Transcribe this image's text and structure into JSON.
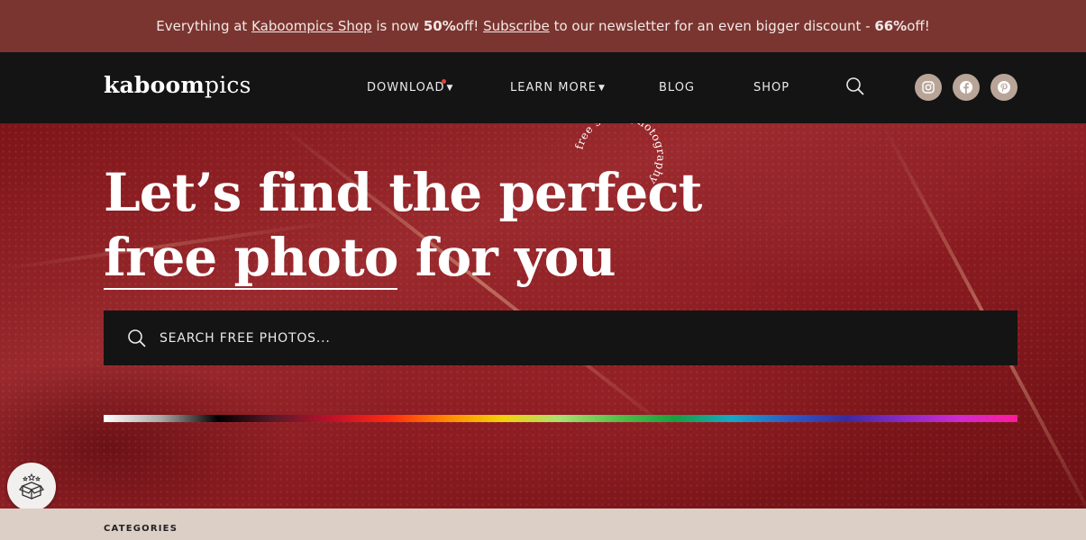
{
  "promo": {
    "prefix": "Everything at ",
    "shop_link": "Kaboompics Shop",
    "middle": " is now ",
    "discount1": "50%",
    "after_discount1": " off! ",
    "subscribe_link": "Subscribe",
    "after_subscribe": " to our newsletter for an even bigger discount - ",
    "discount2": "66%",
    "suffix": " off!",
    "background": "#7a3530"
  },
  "nav": {
    "logo_bold": "kaboom",
    "logo_light": "pics",
    "items": [
      {
        "label": "DOWNLOAD",
        "has_caret": true,
        "has_dot": true
      },
      {
        "label": "LEARN MORE",
        "has_caret": true
      },
      {
        "label": "BLOG"
      },
      {
        "label": "SHOP"
      }
    ],
    "search_icon": "search-icon",
    "social": [
      {
        "name": "instagram-icon"
      },
      {
        "name": "facebook-icon"
      },
      {
        "name": "pinterest-icon"
      }
    ]
  },
  "hero": {
    "line1": "Let’s find the perfect",
    "line2_underlined": "free photo",
    "line2_rest": " for you",
    "badge_text": "free stock photography",
    "search_placeholder": "SEARCH FREE PHOTOS...",
    "palette": [
      "#ffffff",
      "#a9a9a9",
      "#000000",
      "#5a1a2a",
      "#c0102a",
      "#ff2a10",
      "#ff8a00",
      "#f2d20a",
      "#a8e070",
      "#55c04a",
      "#18a040",
      "#16a8c8",
      "#2a5cc8",
      "#3a2aa0",
      "#8a2ac8",
      "#d02ad0",
      "#ff1a9a"
    ]
  },
  "gift_icon": "gift-box-icon",
  "categories": {
    "label": "CATEGORIES"
  }
}
